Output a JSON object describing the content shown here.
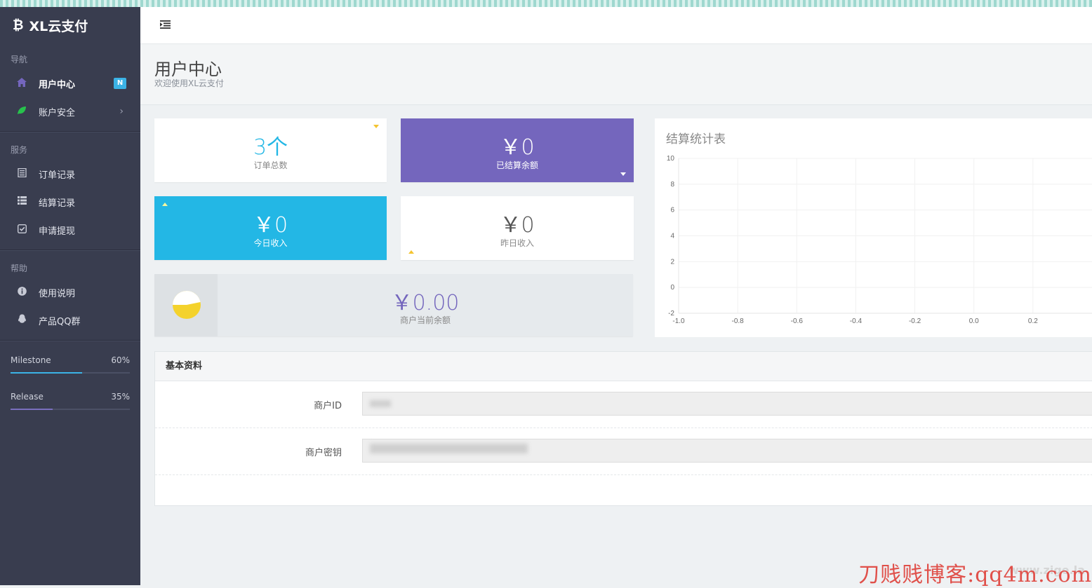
{
  "brand": {
    "icon": "bitcoin-icon",
    "title": "XL云支付"
  },
  "sidebar": {
    "sections": [
      {
        "header": "导航",
        "items": [
          {
            "label": "用户中心",
            "icon": "home-icon",
            "badge": "N",
            "active": true
          },
          {
            "label": "账户安全",
            "icon": "leaf-icon",
            "has_submenu": true
          }
        ]
      },
      {
        "header": "服务",
        "items": [
          {
            "label": "订单记录",
            "icon": "list-alt-icon"
          },
          {
            "label": "结算记录",
            "icon": "th-list-icon"
          },
          {
            "label": "申请提现",
            "icon": "check-square-icon"
          }
        ]
      },
      {
        "header": "帮助",
        "items": [
          {
            "label": "使用说明",
            "icon": "info-circle-icon"
          },
          {
            "label": "产品QQ群",
            "icon": "qq-icon"
          }
        ]
      }
    ],
    "progress": [
      {
        "label": "Milestone",
        "percent_text": "60%",
        "value": 0.6,
        "color": "#3bb3e6"
      },
      {
        "label": "Release",
        "percent_text": "35%",
        "value": 0.35,
        "color": "#7a6fbe"
      }
    ]
  },
  "header": {
    "menu_icon": "indent-icon"
  },
  "page": {
    "title": "用户中心",
    "subtitle": "欢迎使用XL云支付"
  },
  "stats": {
    "orders": {
      "value": "3个",
      "caption": "订单总数"
    },
    "settled": {
      "value": "￥0",
      "caption": "已结算余额"
    },
    "today": {
      "value": "￥0",
      "caption": "今日收入"
    },
    "yesterday": {
      "value": "￥0",
      "caption": "昨日收入"
    },
    "balance": {
      "value": "￥0.00",
      "caption": "商户当前余额"
    }
  },
  "colors": {
    "purple": "#7466bd",
    "cyan": "#23b7e5",
    "yellow": "#f4c430",
    "sidebar": "#393d4f"
  },
  "chart_data": {
    "type": "line",
    "title": "结算统计表",
    "series": [],
    "xlim": [
      -1.0,
      0.2
    ],
    "ylim": [
      -2,
      10
    ],
    "xticks": [
      "-1.0",
      "-0.8",
      "-0.6",
      "-0.4",
      "-0.2",
      "0.0",
      "0.2"
    ],
    "yticks": [
      "10",
      "8",
      "6",
      "4",
      "2",
      "0",
      "-2"
    ],
    "grid": true
  },
  "basic_info": {
    "title": "基本资料",
    "fields": [
      {
        "label": "商户ID"
      },
      {
        "label": "商户密钥"
      }
    ]
  },
  "watermark": {
    "text": "刀贱贱博客:qq4m.com",
    "faint_text": "www.zige.la"
  }
}
